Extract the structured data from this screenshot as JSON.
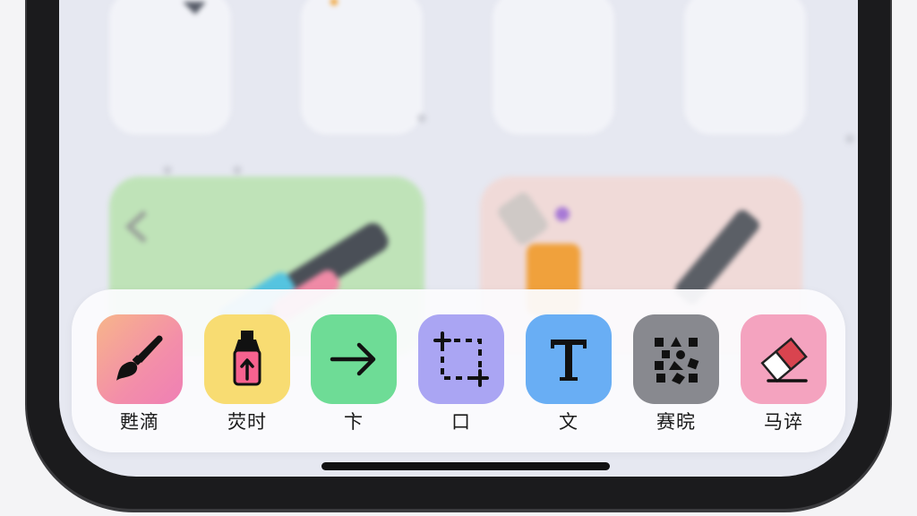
{
  "toolbar": {
    "tools": [
      {
        "label": "甦滴",
        "icon": "paintbrush-icon",
        "color": "#f79aa4"
      },
      {
        "label": "荧时",
        "icon": "highlighter-icon",
        "color": "#f7d96e"
      },
      {
        "label": "卞",
        "icon": "arrow-right-icon",
        "color": "#6fdc95"
      },
      {
        "label": "口",
        "icon": "selection-rectangle-icon",
        "color": "#aba6f3"
      },
      {
        "label": "文",
        "icon": "text-icon",
        "color": "#6aaff3"
      },
      {
        "label": "赛晥",
        "icon": "mosaic-icon",
        "color": "#88898e"
      },
      {
        "label": "马谇",
        "icon": "eraser-icon",
        "color": "#f4a2bd"
      }
    ]
  },
  "colors": {
    "frame": "#1b1b1d",
    "screen": "#e6e8f1",
    "toolbar": "#fbfbfd",
    "home_bar": "#111111"
  }
}
